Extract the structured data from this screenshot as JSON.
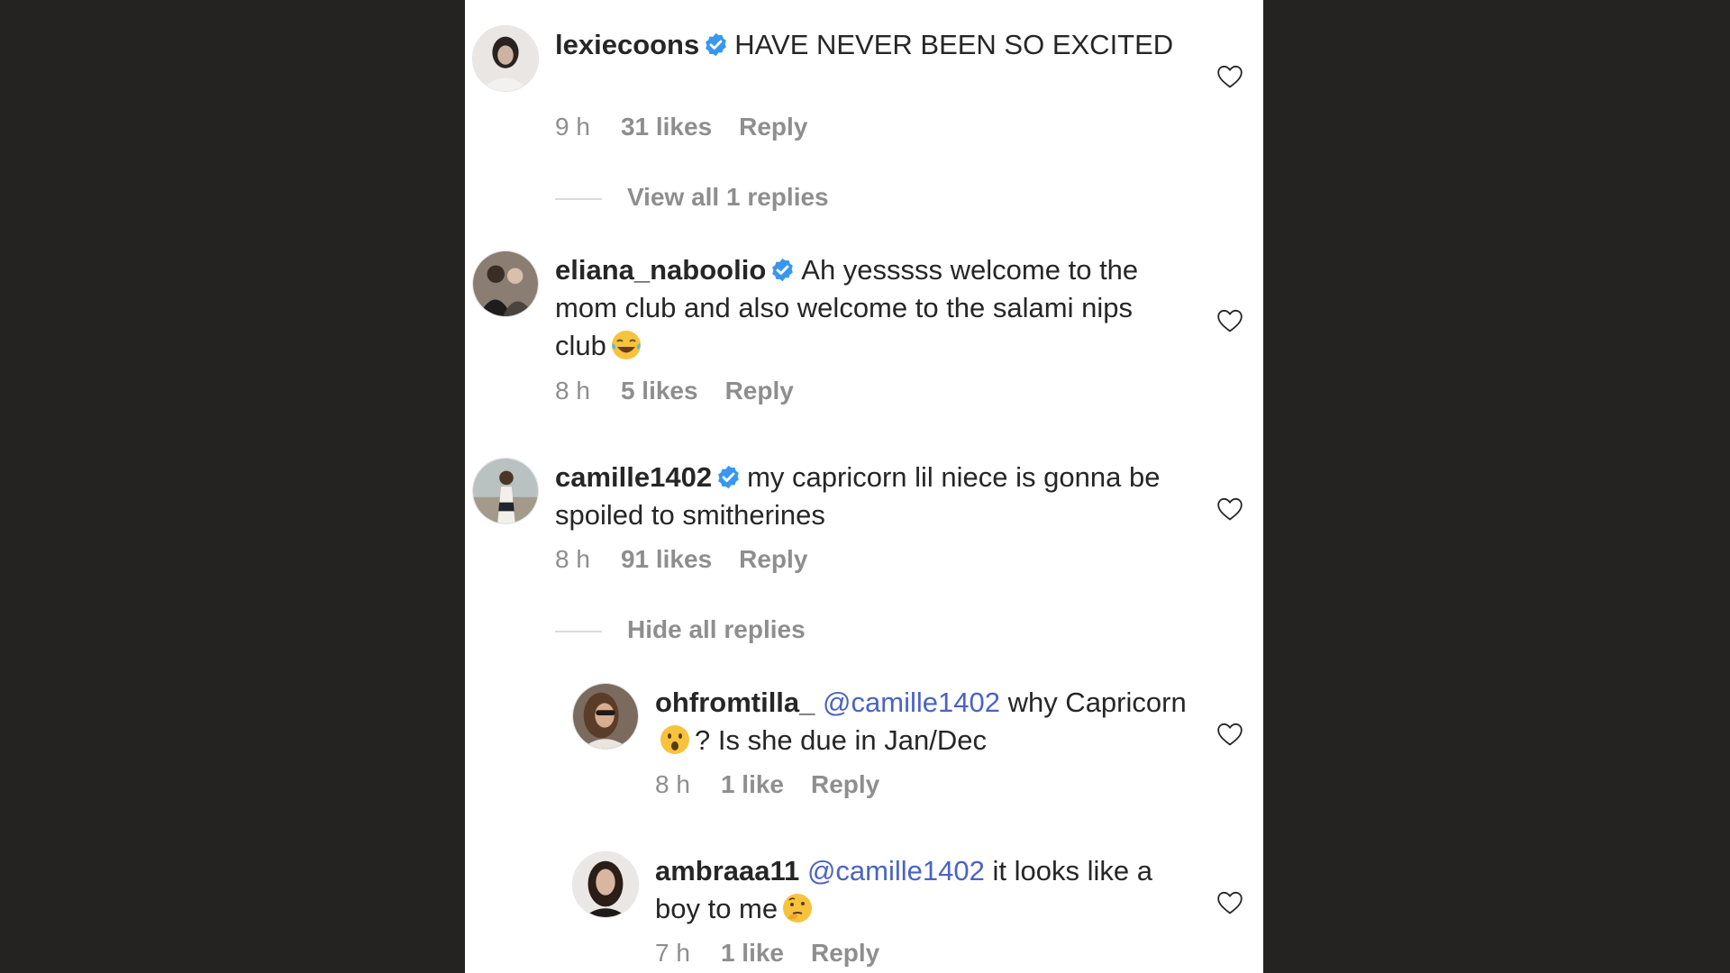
{
  "comments": [
    {
      "username": "lexiecoons",
      "text": "HAVE NEVER BEEN SO EXCITED",
      "time": "9 h",
      "likes": "31 likes",
      "reply": "Reply",
      "thread_toggle": "View all 1 replies"
    },
    {
      "username": "eliana_naboolio",
      "text": "Ah yesssss welcome to the mom club and also welcome to the salami nips club",
      "emoji": "laughing-tears-emoji",
      "time": "8 h",
      "likes": "5 likes",
      "reply": "Reply"
    },
    {
      "username": "camille1402",
      "text": "my capricorn lil niece is gonna be spoiled to smitherines",
      "time": "8 h",
      "likes": "91 likes",
      "reply": "Reply",
      "thread_toggle": "Hide all replies"
    }
  ],
  "replies": [
    {
      "username": "ohfromtilla_",
      "mention": "@camille1402",
      "text_before_emoji": "why Capricorn",
      "emoji": "surprised-face-emoji",
      "text_after_emoji": "? Is she due in Jan/Dec",
      "time": "8 h",
      "likes": "1 like",
      "reply": "Reply"
    },
    {
      "username": "ambraaa11",
      "mention": "@camille1402",
      "text": "it looks like a boy to me",
      "emoji": "thinking-face-emoji",
      "time": "7 h",
      "likes": "1 like",
      "reply": "Reply"
    }
  ],
  "colors": {
    "background": "#252322",
    "panel": "#ffffff",
    "text": "#262626",
    "secondary_text": "#8e8e8e",
    "mention": "#4a63c4",
    "verified_badge": "#3897f0"
  },
  "icons": {
    "verified": "verified-badge-icon",
    "like": "heart-outline-icon"
  }
}
